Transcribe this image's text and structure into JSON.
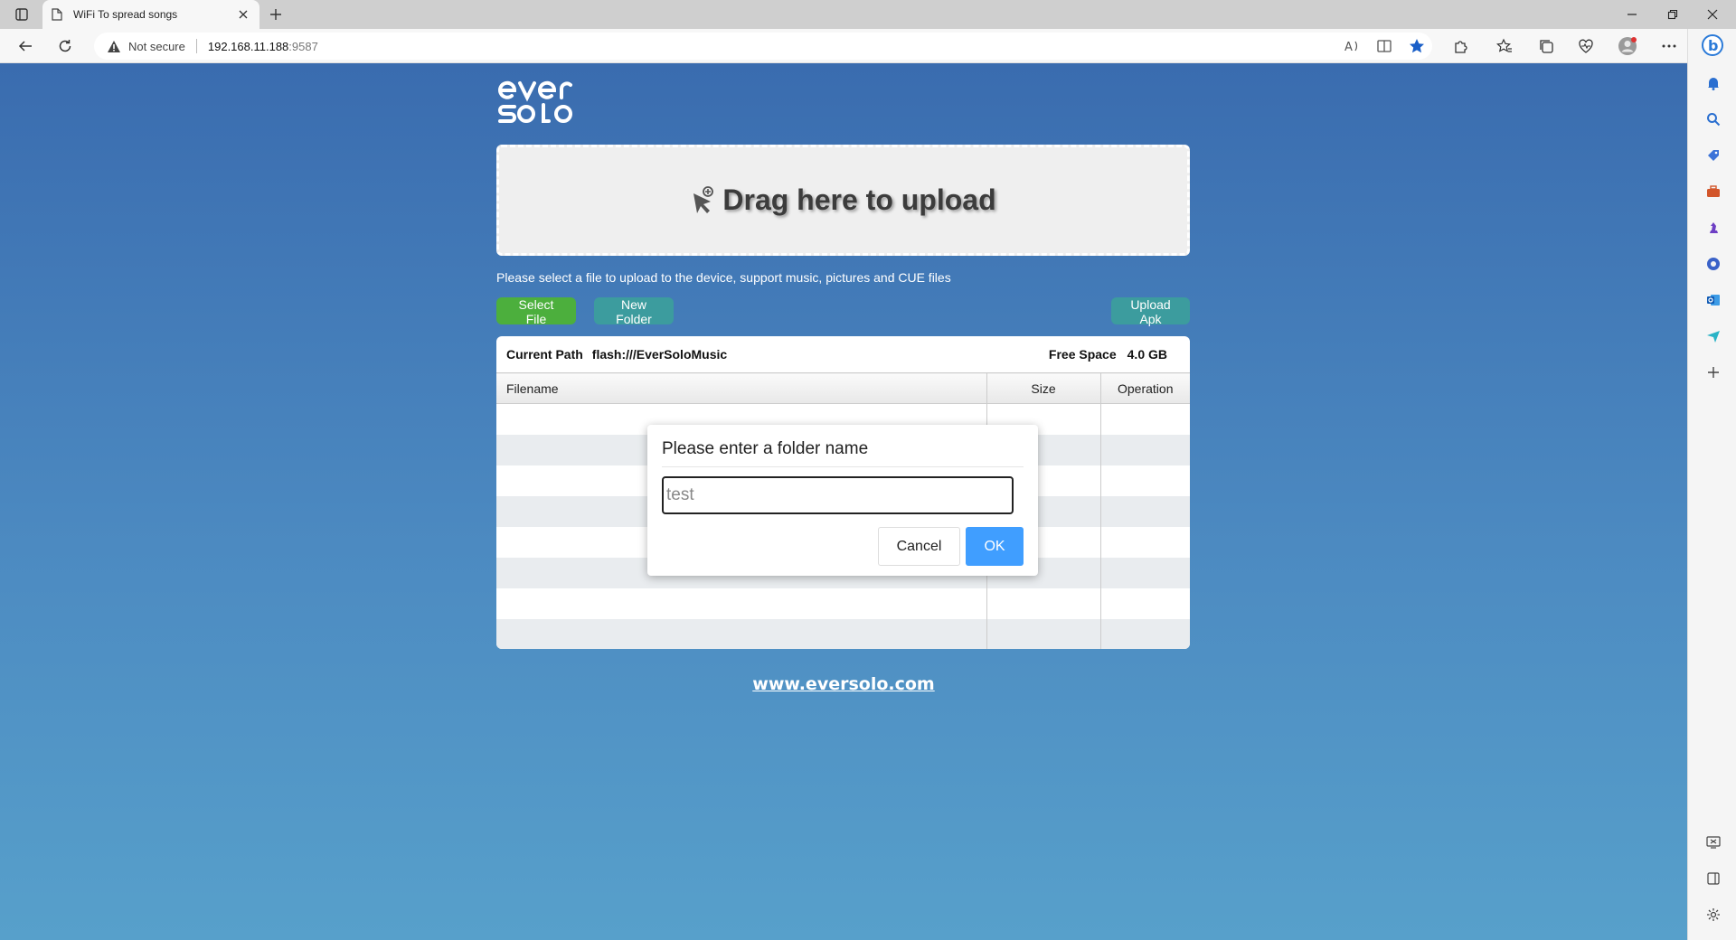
{
  "browser": {
    "tab_title": "WiFi To spread songs",
    "security_label": "Not secure",
    "url_host": "192.168.11.188",
    "url_port": ":9587"
  },
  "page": {
    "logo_text": "ever solo",
    "dropzone_label": "Drag here to upload",
    "hint": "Please select a file to upload to the device, support music, pictures and CUE files",
    "buttons": {
      "select_file": "Select File",
      "new_folder": "New Folder",
      "upload_apk": "Upload Apk"
    },
    "panel": {
      "current_path_label": "Current Path",
      "current_path_value": "flash:///EverSoloMusic",
      "free_space_label": "Free Space",
      "free_space_value": "4.0 GB",
      "columns": {
        "filename": "Filename",
        "size": "Size",
        "operation": "Operation"
      }
    },
    "footer_link": "www.eversolo.com"
  },
  "dialog": {
    "title": "Please enter a folder name",
    "input_value": "test",
    "cancel_label": "Cancel",
    "ok_label": "OK"
  },
  "colors": {
    "background_top": "#3a6caf",
    "background_bottom": "#57a0cb",
    "select_button": "#4caf3d",
    "teal_button": "#3c9c9e",
    "ok_button": "#409eff"
  }
}
